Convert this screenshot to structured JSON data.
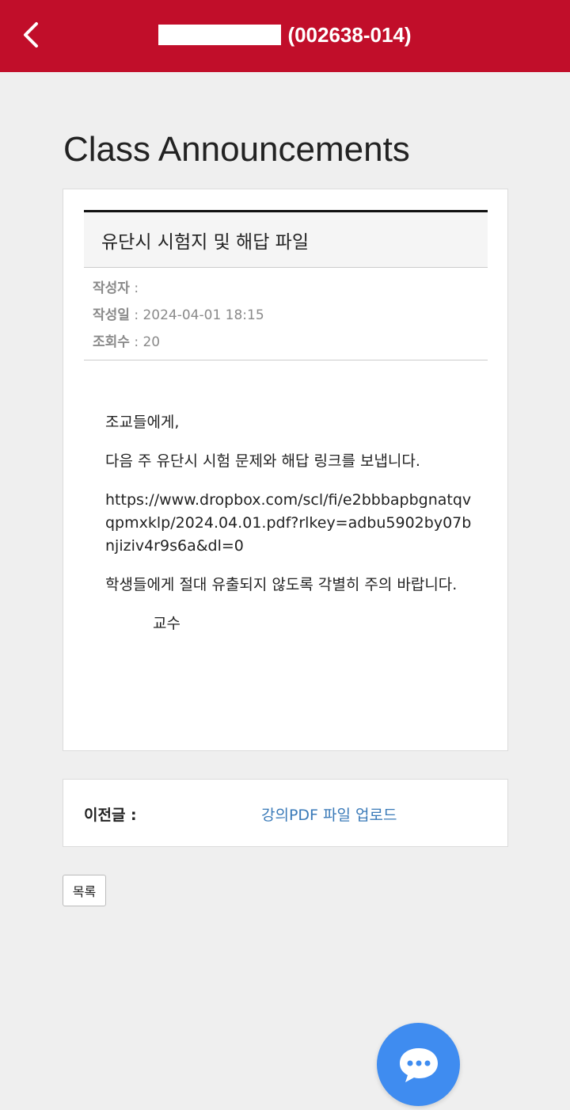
{
  "header": {
    "course_code": "(002638-014)",
    "accent_color": "#c10e2a"
  },
  "page": {
    "title": "Class Announcements"
  },
  "post": {
    "subject": "유단시 시험지 및 해답 파일",
    "meta": {
      "author_label": "작성자",
      "author_value": "",
      "date_label": "작성일",
      "date_value": "2024-04-01 18:15",
      "views_label": "조회수",
      "views_value": "20"
    },
    "body": {
      "greeting": "조교들에게,",
      "line1": "다음 주 유단시 시험 문제와 해답 링크를 보냅니다.",
      "link": "https://www.dropbox.com/scl/fi/e2bbbapbgnatqvqpmxklp/2024.04.01.pdf?rlkey=adbu5902by07bnjiziv4r9s6a&dl=0",
      "line2": "학생들에게 절대 유출되지 않도록 각별히 주의 바랍니다.",
      "signature": "교수"
    }
  },
  "navigation": {
    "prev_label": "이전글 :",
    "prev_title": "강의PDF 파일 업로드",
    "list_button": "목록"
  },
  "icons": {
    "back": "chevron-left-icon",
    "chat": "chat-bubble-icon"
  }
}
